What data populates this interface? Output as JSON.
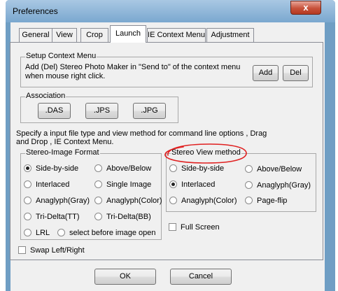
{
  "window": {
    "title": "Preferences",
    "close_label": "x"
  },
  "tabs": [
    {
      "label": "General"
    },
    {
      "label": "View"
    },
    {
      "label": "Crop"
    },
    {
      "label": "Launch",
      "active": true
    },
    {
      "label": "IE Context Menu"
    },
    {
      "label": "Adjustment"
    }
  ],
  "setup_context_menu": {
    "title": "Setup Context Menu",
    "description_line1": "Add (Del) Stereo Photo Maker in \"Send to\" of the context menu",
    "description_line2": "when mouse right click.",
    "add_label": "Add",
    "del_label": "Del"
  },
  "association": {
    "title": "Association",
    "buttons": [
      ".DAS",
      ".JPS",
      ".JPG"
    ]
  },
  "specify_text_line1": "Specify a input file type and view method for command line options , Drag",
  "specify_text_line2": "and Drop , IE Context Menu.",
  "stereo_image_format": {
    "title": "Stereo-Image Format",
    "options": [
      {
        "label": "Side-by-side",
        "selected": true
      },
      {
        "label": "Above/Below",
        "selected": false
      },
      {
        "label": "Interlaced",
        "selected": false
      },
      {
        "label": "Single Image",
        "selected": false
      },
      {
        "label": "Anaglyph(Gray)",
        "selected": false
      },
      {
        "label": "Anaglyph(Color)",
        "selected": false
      },
      {
        "label": "Tri-Delta(TT)",
        "selected": false
      },
      {
        "label": "Tri-Delta(BB)",
        "selected": false
      },
      {
        "label": "LRL",
        "selected": false
      },
      {
        "label": "select before image open",
        "selected": false
      }
    ]
  },
  "stereo_view_method": {
    "title": "Stereo View method",
    "options": [
      {
        "label": "Side-by-side",
        "selected": false
      },
      {
        "label": "Above/Below",
        "selected": false
      },
      {
        "label": "Interlaced",
        "selected": true
      },
      {
        "label": "Anaglyph(Gray)",
        "selected": false
      },
      {
        "label": "Anaglyph(Color)",
        "selected": false
      },
      {
        "label": "Page-flip",
        "selected": false
      }
    ]
  },
  "full_screen": {
    "label": "Full Screen",
    "checked": false
  },
  "swap_left_right": {
    "label": "Swap Left/Right",
    "checked": false
  },
  "footer": {
    "ok_label": "OK",
    "cancel_label": "Cancel"
  },
  "colors": {
    "annotation": "#e02020",
    "accent": "#6f9ec4",
    "close": "#c7513a"
  }
}
